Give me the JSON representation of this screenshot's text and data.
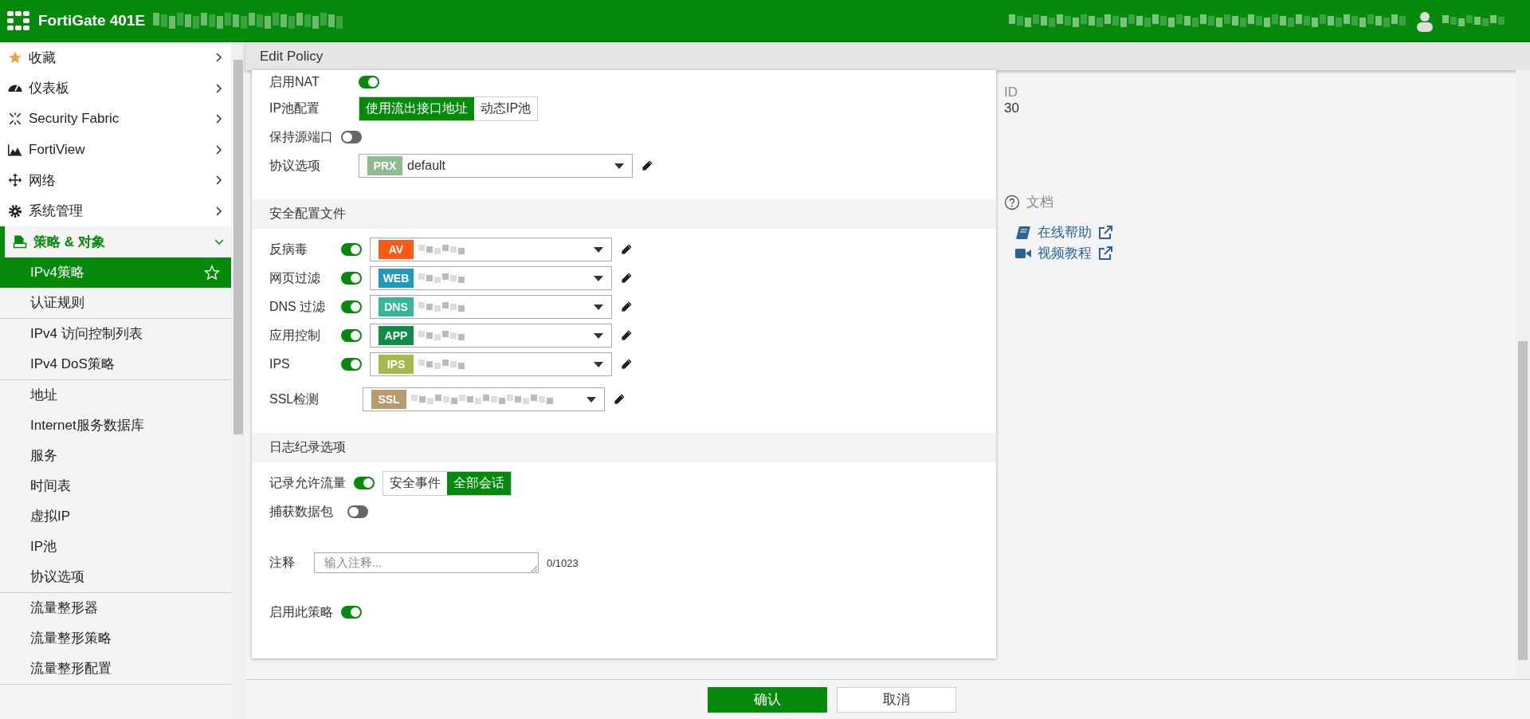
{
  "header": {
    "product": "FortiGate 401E"
  },
  "sidebar": {
    "items": [
      {
        "label": "收藏",
        "expanded": false
      },
      {
        "label": "仪表板",
        "expanded": false
      },
      {
        "label": "Security Fabric",
        "expanded": false
      },
      {
        "label": "FortiView",
        "expanded": false
      },
      {
        "label": "网络",
        "expanded": false
      },
      {
        "label": "系统管理",
        "expanded": false
      },
      {
        "label": "策略 & 对象",
        "expanded": true,
        "sections": [
          {
            "items": [
              {
                "label": "IPv4策略",
                "selected": true
              },
              {
                "label": "认证规则",
                "selected": false
              }
            ]
          },
          {
            "items": [
              {
                "label": "IPv4 访问控制列表",
                "selected": false
              },
              {
                "label": "IPv4 DoS策略",
                "selected": false
              }
            ]
          },
          {
            "items": [
              {
                "label": "地址",
                "selected": false
              },
              {
                "label": "Internet服务数据库",
                "selected": false
              },
              {
                "label": "服务",
                "selected": false
              },
              {
                "label": "时间表",
                "selected": false
              },
              {
                "label": "虚拟IP",
                "selected": false
              },
              {
                "label": "IP池",
                "selected": false
              },
              {
                "label": "协议选项",
                "selected": false
              }
            ]
          },
          {
            "items": [
              {
                "label": "流量整形器",
                "selected": false
              },
              {
                "label": "流量整形策略",
                "selected": false
              },
              {
                "label": "流量整形配置",
                "selected": false
              }
            ]
          }
        ]
      }
    ]
  },
  "page_title": "Edit Policy",
  "form": {
    "nat": {
      "label": "启用NAT",
      "on": true
    },
    "ip_pool": {
      "label": "IP池配置",
      "options": [
        {
          "label": "使用流出接口地址",
          "selected": true
        },
        {
          "label": "动态IP池",
          "selected": false
        }
      ]
    },
    "preserve_port": {
      "label": "保持源端口",
      "on": false
    },
    "protocol_options": {
      "label": "协议选项",
      "badge": "PRX",
      "color": "#8fbc8f",
      "value": "default"
    },
    "security_profiles": {
      "title": "安全配置文件",
      "rows": [
        {
          "kind": "toggle",
          "label": "反病毒",
          "on": true,
          "badge": "AV",
          "color": "#ff5a14"
        },
        {
          "kind": "toggle",
          "label": "网页过滤",
          "on": true,
          "badge": "WEB",
          "color": "#1c9ac0"
        },
        {
          "kind": "toggle",
          "label": "DNS 过滤",
          "on": true,
          "badge": "DNS",
          "color": "#34b898"
        },
        {
          "kind": "toggle",
          "label": "应用控制",
          "on": true,
          "badge": "APP",
          "color": "#0f8f45"
        },
        {
          "kind": "toggle",
          "label": "IPS",
          "on": true,
          "badge": "IPS",
          "color": "#a8b84a"
        },
        {
          "kind": "plain",
          "label": "SSL检测",
          "badge": "SSL",
          "color": "#b89a6c"
        }
      ]
    },
    "logging": {
      "title": "日志纪录选项",
      "log_traffic": {
        "label": "记录允许流量",
        "on": true,
        "options": [
          {
            "label": "安全事件",
            "selected": false
          },
          {
            "label": "全部会话",
            "selected": true
          }
        ]
      },
      "capture": {
        "label": "捕获数据包",
        "on": false
      },
      "comment": {
        "label": "注释",
        "placeholder": "输入注释...",
        "counter": "0/1023"
      },
      "enable": {
        "label": "启用此策略",
        "on": true
      }
    }
  },
  "info": {
    "id_label": "ID",
    "id_value": "30",
    "docs_title": "文档",
    "links": [
      {
        "label": "在线帮助"
      },
      {
        "label": "视频教程"
      }
    ]
  },
  "footer": {
    "buttons": [
      {
        "label": "确认",
        "kind": "primary"
      },
      {
        "label": "取消",
        "kind": "secondary"
      }
    ]
  }
}
